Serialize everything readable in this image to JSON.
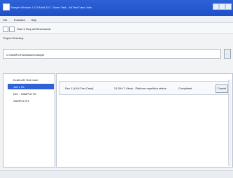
{
  "window": {
    "title": "Sample Window 1.2.3 Build 123 - Some Task - All Test Case Jobs"
  },
  "menu": {
    "items": [
      "File",
      "Emulator",
      "Help"
    ]
  },
  "toolbar": {
    "path": "Start It   Stop All   Reschedule"
  },
  "project": {
    "label": "Project Directory",
    "value": "C:\\SAMPLE\\Software\\example",
    "browse_label": "..."
  },
  "tree": {
    "items": [
      "Eval/LAN Test Case",
      "Job 1 R1",
      "Dev - SAMPLE R1",
      "SAMPLE R1"
    ],
    "selected_index": 1
  },
  "tasks": [
    {
      "name": "Dev 1 [LAN Test Case]",
      "time": "21:38:47 Likely - Platform repetition status",
      "status": "Completed",
      "action": "Cancel"
    }
  ],
  "status": {
    "text": ""
  }
}
